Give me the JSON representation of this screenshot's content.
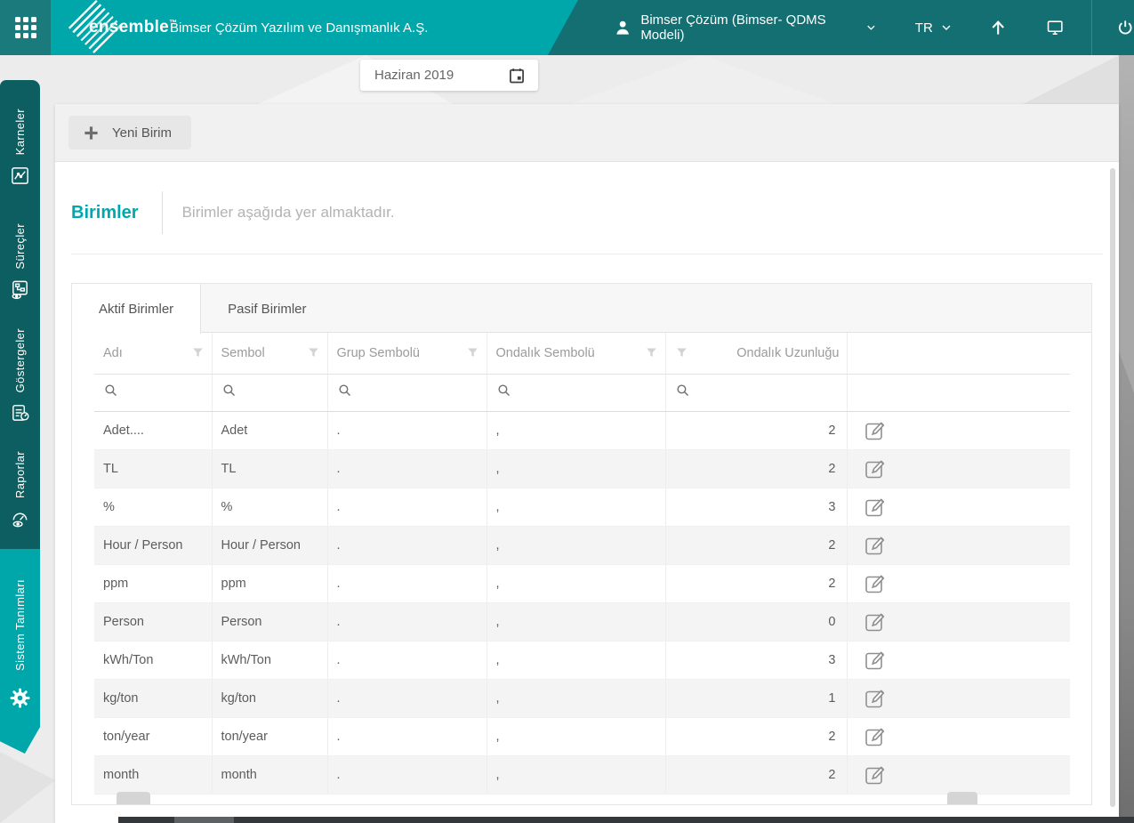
{
  "header": {
    "logo_text": "ensemble",
    "logo_tm": "™",
    "company_name": "Bimser Çözüm Yazılım ve Danışmanlık A.Ş.",
    "account_label": "Bimser Çözüm (Bimser- QDMS Modeli)",
    "language_label": "TR"
  },
  "date_filter": {
    "value": "Haziran 2019"
  },
  "sidebar": {
    "items": [
      {
        "label": "Karneler",
        "icon": "scorecard-chart-icon",
        "active": false
      },
      {
        "label": "Süreçler",
        "icon": "process-eye-icon",
        "active": false
      },
      {
        "label": "Göstergeler",
        "icon": "clipboard-gauge-icon",
        "active": false
      },
      {
        "label": "Raporlar",
        "icon": "gauge-eye-icon",
        "active": false
      },
      {
        "label": "Sistem Tanımları",
        "icon": "gear-icon",
        "active": true
      }
    ]
  },
  "toolbar": {
    "new_button_label": "Yeni Birim"
  },
  "page": {
    "title": "Birimler",
    "subtitle": "Birimler aşağıda yer almaktadır."
  },
  "tabs": [
    {
      "label": "Aktif Birimler",
      "active": true
    },
    {
      "label": "Pasif Birimler",
      "active": false
    }
  ],
  "table": {
    "columns": [
      {
        "label": "Adı",
        "filter": true,
        "search": true,
        "align": "left",
        "filter_side": "right"
      },
      {
        "label": "Sembol",
        "filter": true,
        "search": true,
        "align": "left",
        "filter_side": "right"
      },
      {
        "label": "Grup Sembolü",
        "filter": true,
        "search": true,
        "align": "left",
        "filter_side": "right"
      },
      {
        "label": "Ondalık Sembolü",
        "filter": true,
        "search": true,
        "align": "left",
        "filter_side": "right"
      },
      {
        "label": "Ondalık Uzunluğu",
        "filter": true,
        "search": true,
        "align": "right",
        "filter_side": "left"
      },
      {
        "label": "",
        "filter": false,
        "search": false,
        "align": "left",
        "filter_side": "none"
      }
    ],
    "rows": [
      [
        "Adet....",
        "Adet",
        ".",
        ",",
        "2"
      ],
      [
        "TL",
        "TL",
        ".",
        ",",
        "2"
      ],
      [
        "%",
        "%",
        ".",
        ",",
        "3"
      ],
      [
        "Hour / Person",
        "Hour / Person",
        ".",
        ",",
        "2"
      ],
      [
        "ppm",
        "ppm",
        ".",
        ",",
        "2"
      ],
      [
        "Person",
        "Person",
        ".",
        ",",
        "0"
      ],
      [
        "kWh/Ton",
        "kWh/Ton",
        ".",
        ",",
        "3"
      ],
      [
        "kg/ton",
        "kg/ton",
        ".",
        ",",
        "1"
      ],
      [
        "ton/year",
        "ton/year",
        ".",
        ",",
        "2"
      ],
      [
        "month",
        "month",
        ".",
        ",",
        "2"
      ]
    ]
  },
  "icons": {
    "app-grid-icon": "3x3 dot grid",
    "user-icon": "person silhouette",
    "chevron-down-icon": "v",
    "upload-icon": "↑",
    "monitor-icon": "desktop display",
    "power-icon": "⏻",
    "calendar-icon": "calendar",
    "plus-icon": "+",
    "filter-icon": "funnel",
    "search-icon": "magnifier",
    "edit-icon": "pencil in square",
    "gear-icon": "⚙"
  },
  "colors": {
    "accent_teal": "#00a7aa",
    "header_right_teal": "#136f72",
    "app_square_teal": "#1b7a7c",
    "sidebar_dark_teal": "#0d5e60",
    "title_teal": "#00a7ae",
    "row_alt_bg": "#f4f4f4",
    "scrollbar_dark": "#35383b"
  }
}
